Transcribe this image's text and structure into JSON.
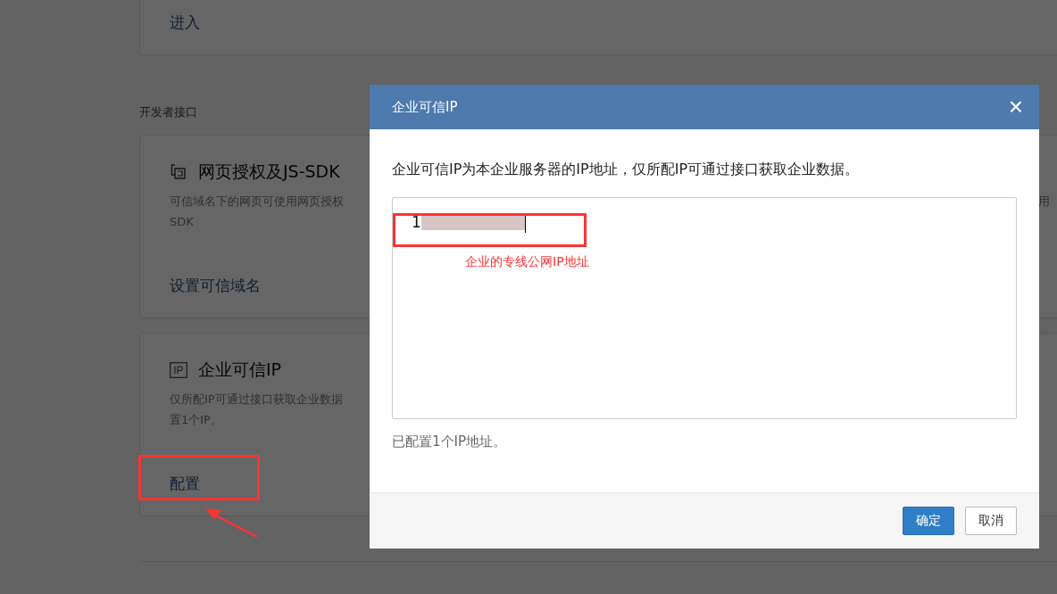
{
  "page": {
    "top_card": {
      "link": "进入"
    },
    "section_title": "开发者接口",
    "cards": [
      {
        "kind": "domain",
        "title": "网页授权及JS-SDK",
        "description": [
          "可信域名下的网页可使用网页授权",
          "SDK"
        ],
        "edge_text": "用",
        "link": "设置可信域名"
      },
      {
        "kind": "ip",
        "title": "企业可信IP",
        "description": [
          "仅所配IP可通过接口获取企业数据",
          "置1个IP。"
        ],
        "link": "配置"
      }
    ]
  },
  "dialog": {
    "title": "企业可信IP",
    "close": "×",
    "intro": "企业可信IP为本企业服务器的IP地址，仅所配IP可通过接口获取企业数据。",
    "ip_value": "1",
    "note": "已配置1个IP地址。",
    "buttons": [
      {
        "label": "确定",
        "kind": "primary"
      },
      {
        "label": "取消",
        "kind": "secondary"
      }
    ]
  },
  "annotations": {
    "ip_label": "企业的专线公网IP地址"
  }
}
